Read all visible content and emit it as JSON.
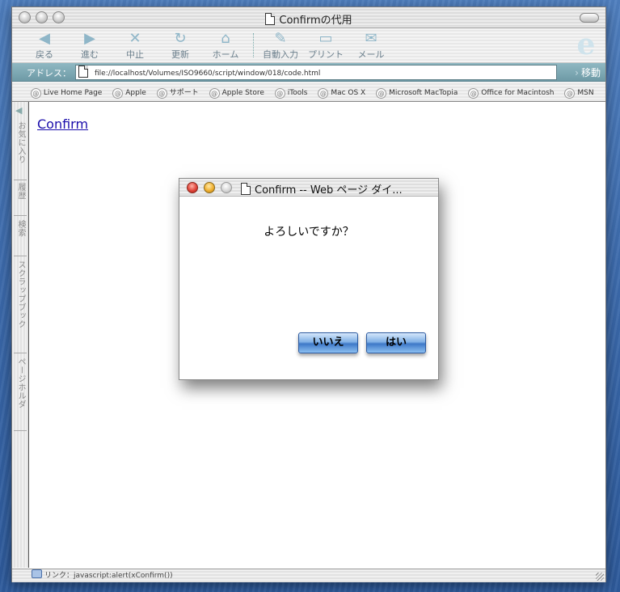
{
  "window": {
    "title": "Confirmの代用"
  },
  "toolbar": {
    "back": "戻る",
    "forward": "進む",
    "stop": "中止",
    "refresh": "更新",
    "home": "ホーム",
    "autofill": "自動入力",
    "print": "プリント",
    "mail": "メール"
  },
  "address": {
    "label": "アドレス：",
    "url": "file://localhost/Volumes/ISO9660/script/window/018/code.html",
    "go": "移動"
  },
  "favorites": [
    "Live Home Page",
    "Apple",
    "サポート",
    "Apple Store",
    "iTools",
    "Mac OS X",
    "Microsoft MacTopia",
    "Office for Macintosh",
    "MSN"
  ],
  "sidebar": {
    "tabs": [
      "お気に入り",
      "履歴",
      "検索",
      "スクラップブック",
      "ページホルダ"
    ]
  },
  "page": {
    "link": "Confirm"
  },
  "dialog": {
    "title": "Confirm -- Web ページ ダイ...",
    "message": "よろしいですか？",
    "no_label": "いいえ",
    "yes_label": "はい"
  },
  "status": {
    "text": "リンク：javascript:alert(xConfirm())"
  }
}
